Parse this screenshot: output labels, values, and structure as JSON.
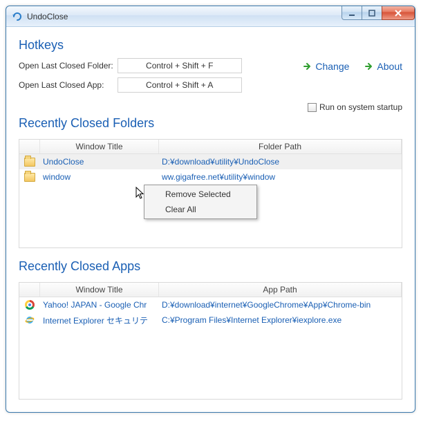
{
  "titlebar": {
    "title": "UndoClose"
  },
  "sections": {
    "hotkeys_title": "Hotkeys",
    "folders_title": "Recently Closed Folders",
    "apps_title": "Recently Closed Apps"
  },
  "hotkeys": {
    "folder_label": "Open Last Closed Folder:",
    "folder_value": "Control + Shift + F",
    "app_label": "Open Last Closed App:",
    "app_value": "Control + Shift + A"
  },
  "links": {
    "change": "Change",
    "about": "About"
  },
  "startup": {
    "label": "Run on system startup",
    "checked": false
  },
  "folders_table": {
    "headers": {
      "title": "Window Title",
      "path": "Folder Path"
    },
    "rows": [
      {
        "title": "UndoClose",
        "path": "D:¥download¥utility¥UndoClose",
        "selected": true
      },
      {
        "title": "window",
        "path": "ww.gigafree.net¥utility¥window",
        "selected": false
      }
    ]
  },
  "apps_table": {
    "headers": {
      "title": "Window Title",
      "path": "App Path"
    },
    "rows": [
      {
        "icon": "chrome",
        "title": "Yahoo! JAPAN - Google Chr",
        "path": "D:¥download¥internet¥GoogleChrome¥App¥Chrome-bin"
      },
      {
        "icon": "ie",
        "title": "Internet Explorer セキュリテ",
        "path": "C:¥Program Files¥Internet Explorer¥iexplore.exe"
      }
    ]
  },
  "context_menu": {
    "remove": "Remove Selected",
    "clear": "Clear All"
  }
}
